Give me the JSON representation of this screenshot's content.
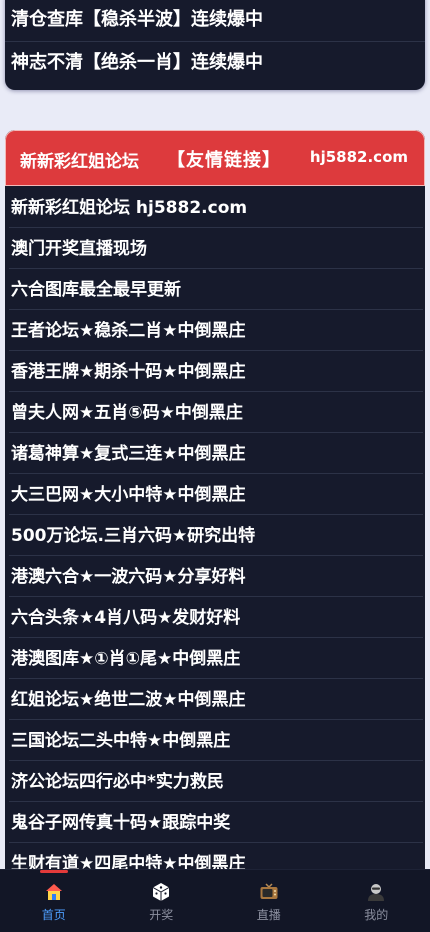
{
  "top_card": {
    "rows": [
      "清仓查库【稳杀半波】连续爆中",
      "神志不清【绝杀一肖】连续爆中"
    ]
  },
  "banner": {
    "left": "新新彩红姐论坛",
    "middle": "【友情链接】",
    "right": "hj5882.com"
  },
  "links": [
    "新新彩红姐论坛 hj5882.com",
    "澳门开奖直播现场",
    "六合图库最全最早更新",
    "王者论坛★稳杀二肖★中倒黑庄",
    "香港王牌★期杀十码★中倒黑庄",
    "曾夫人网★五肖⑤码★中倒黑庄",
    "诸葛神算★复式三连★中倒黑庄",
    "大三巴网★大小中特★中倒黑庄",
    "500万论坛.三肖六码★研究出特",
    "港澳六合★一波六码★分享好料",
    "六合头条★4肖八码★发财好料",
    "港澳图库★①肖①尾★中倒黑庄",
    "红姐论坛★绝世二波★中倒黑庄",
    "三国论坛二头中特★中倒黑庄",
    "济公论坛四行必中*实力救民",
    "鬼谷子网传真十码★跟踪中奖",
    "生财有道★四尾中特★中倒黑庄"
  ],
  "tabbar": {
    "items": [
      {
        "label": "首页",
        "icon": "home-icon",
        "active": true
      },
      {
        "label": "开奖",
        "icon": "dice-icon",
        "active": false
      },
      {
        "label": "直播",
        "icon": "tv-icon",
        "active": false
      },
      {
        "label": "我的",
        "icon": "user-icon",
        "active": false
      }
    ]
  },
  "colors": {
    "background": "#e9ebf7",
    "card": "#161a2c",
    "banner": "#dd3a3d",
    "active_tab": "#4d9fff",
    "inactive_tab": "#8b8f9f"
  }
}
